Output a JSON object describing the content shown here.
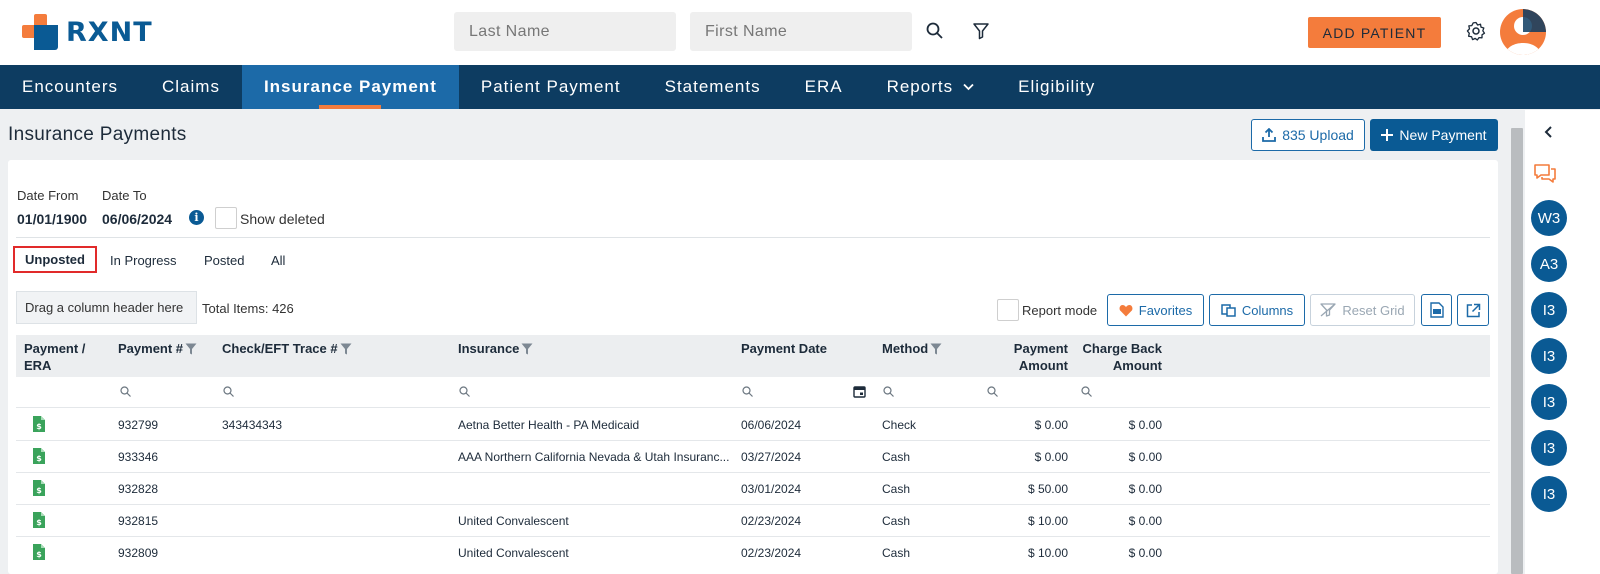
{
  "app": {
    "logo_text": "RXNT"
  },
  "header": {
    "last_name_placeholder": "Last Name",
    "first_name_placeholder": "First Name",
    "add_patient_label": "ADD PATIENT"
  },
  "nav": {
    "items": [
      {
        "label": "Encounters"
      },
      {
        "label": "Claims"
      },
      {
        "label": "Insurance Payment",
        "active": true
      },
      {
        "label": "Patient Payment"
      },
      {
        "label": "Statements"
      },
      {
        "label": "ERA"
      },
      {
        "label": "Reports"
      },
      {
        "label": "Eligibility"
      }
    ]
  },
  "page": {
    "title": "Insurance Payments",
    "upload_label": "835 Upload",
    "new_payment_label": "New Payment"
  },
  "filters": {
    "date_from_label": "Date From",
    "date_from_value": "01/01/1900",
    "date_to_label": "Date To",
    "date_to_value": "06/06/2024",
    "show_deleted_label": "Show deleted"
  },
  "tabs": [
    {
      "label": "Unposted",
      "selected": true
    },
    {
      "label": "In Progress"
    },
    {
      "label": "Posted"
    },
    {
      "label": "All"
    }
  ],
  "grid": {
    "group_hint": "Drag a column header here",
    "total_items": "Total Items: 426",
    "report_mode_label": "Report mode",
    "favorites_label": "Favorites",
    "columns_label": "Columns",
    "reset_grid_label": "Reset Grid",
    "headers": {
      "payment_era_1": "Payment /",
      "payment_era_2": "ERA",
      "payment_no": "Payment #",
      "check_eft": "Check/EFT Trace #",
      "insurance": "Insurance",
      "payment_date": "Payment Date",
      "method": "Method",
      "payment_amount_1": "Payment",
      "payment_amount_2": "Amount",
      "charge_back_1": "Charge Back",
      "charge_back_2": "Amount"
    },
    "rows": [
      {
        "payment_no": "932799",
        "check_eft": "343434343",
        "insurance": "Aetna Better Health - PA Medicaid",
        "payment_date": "06/06/2024",
        "method": "Check",
        "payment_amount": "$ 0.00",
        "charge_back": "$ 0.00"
      },
      {
        "payment_no": "933346",
        "check_eft": "",
        "insurance": "AAA Northern California Nevada & Utah Insuranc...",
        "payment_date": "03/27/2024",
        "method": "Cash",
        "payment_amount": "$ 0.00",
        "charge_back": "$ 0.00"
      },
      {
        "payment_no": "932828",
        "check_eft": "",
        "insurance": "",
        "payment_date": "03/01/2024",
        "method": "Cash",
        "payment_amount": "$ 50.00",
        "charge_back": "$ 0.00"
      },
      {
        "payment_no": "932815",
        "check_eft": "",
        "insurance": "United Convalescent",
        "payment_date": "02/23/2024",
        "method": "Cash",
        "payment_amount": "$ 10.00",
        "charge_back": "$ 0.00"
      },
      {
        "payment_no": "932809",
        "check_eft": "",
        "insurance": "United Convalescent",
        "payment_date": "02/23/2024",
        "method": "Cash",
        "payment_amount": "$ 10.00",
        "charge_back": "$ 0.00"
      }
    ]
  },
  "rail": {
    "badges": [
      "W3",
      "A3",
      "I3",
      "I3",
      "I3",
      "I3",
      "I3"
    ]
  },
  "colors": {
    "brand_blue": "#0a5a94",
    "nav_bg": "#0d3c61",
    "accent_orange": "#f47c3c",
    "doc_green": "#3aa35b"
  }
}
